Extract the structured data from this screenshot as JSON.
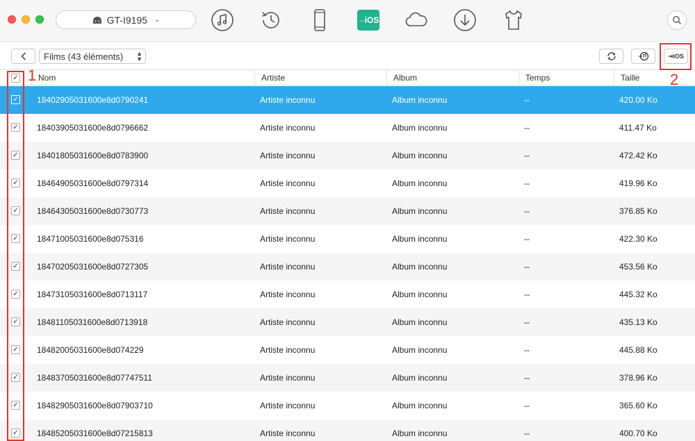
{
  "device": {
    "name": "GT-I9195"
  },
  "nav": {
    "ios_label": "iOS"
  },
  "toolbar": {
    "category_label": "Films (43 éléments)",
    "to_ios_label": "iOS"
  },
  "columns": {
    "name": "Nom",
    "artist": "Artiste",
    "album": "Album",
    "time": "Temps",
    "size": "Taille"
  },
  "rows": [
    {
      "name": "18402905031600e8d0790241",
      "artist": "Artiste inconnu",
      "album": "Album inconnu",
      "time": "--",
      "size": "420.00 Ko"
    },
    {
      "name": "18403905031600e8d0796662",
      "artist": "Artiste inconnu",
      "album": "Album inconnu",
      "time": "--",
      "size": "411.47 Ko"
    },
    {
      "name": "18401805031600e8d0783900",
      "artist": "Artiste inconnu",
      "album": "Album inconnu",
      "time": "--",
      "size": "472.42 Ko"
    },
    {
      "name": "18464905031600e8d0797314",
      "artist": "Artiste inconnu",
      "album": "Album inconnu",
      "time": "--",
      "size": "419.96 Ko"
    },
    {
      "name": "18464305031600e8d0730773",
      "artist": "Artiste inconnu",
      "album": "Album inconnu",
      "time": "--",
      "size": "376.85 Ko"
    },
    {
      "name": "18471005031600e8d075316",
      "artist": "Artiste inconnu",
      "album": "Album inconnu",
      "time": "--",
      "size": "422.30 Ko"
    },
    {
      "name": "18470205031600e8d0727305",
      "artist": "Artiste inconnu",
      "album": "Album inconnu",
      "time": "--",
      "size": "453.56 Ko"
    },
    {
      "name": "18473105031600e8d0713117",
      "artist": "Artiste inconnu",
      "album": "Album inconnu",
      "time": "--",
      "size": "445.32 Ko"
    },
    {
      "name": "18481105031600e8d0713918",
      "artist": "Artiste inconnu",
      "album": "Album inconnu",
      "time": "--",
      "size": "435.13 Ko"
    },
    {
      "name": "18482005031600e8d074229",
      "artist": "Artiste inconnu",
      "album": "Album inconnu",
      "time": "--",
      "size": "445.88 Ko"
    },
    {
      "name": "18483705031600e8d07747511",
      "artist": "Artiste inconnu",
      "album": "Album inconnu",
      "time": "--",
      "size": "378.96 Ko"
    },
    {
      "name": "18482905031600e8d07903710",
      "artist": "Artiste inconnu",
      "album": "Album inconnu",
      "time": "--",
      "size": "365.60 Ko"
    },
    {
      "name": "18485205031600e8d07215813",
      "artist": "Artiste inconnu",
      "album": "Album inconnu",
      "time": "--",
      "size": "400.70 Ko"
    }
  ],
  "annotations": {
    "step1": "1",
    "step2": "2"
  },
  "colors": {
    "selected_row": "#2fa9eb",
    "accent_ios": "#1fb48b",
    "annotation": "#e8332a"
  },
  "icons": [
    "android-icon",
    "music-icon",
    "history-icon",
    "phone-icon",
    "to-ios-icon",
    "cloud-icon",
    "download-icon",
    "tshirt-icon",
    "search-icon",
    "back-chevron-icon",
    "refresh-icon",
    "itunes-icon"
  ]
}
